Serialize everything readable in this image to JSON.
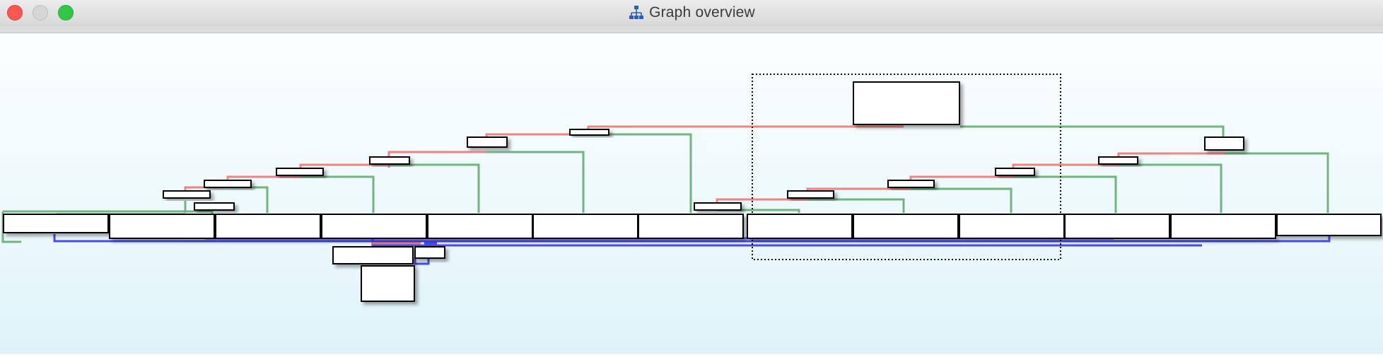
{
  "window": {
    "title": "Graph overview"
  },
  "colors": {
    "edge_red": "#ef7c7c",
    "edge_green": "#6cb07c",
    "edge_blue": "#2d2df0",
    "canvas_top": "#fbfeff",
    "canvas_bottom": "#def3f9"
  },
  "icons": {
    "close": "close-icon",
    "minimize": "minimize-icon",
    "zoom": "zoom-icon",
    "graph": "graph-tree-icon"
  }
}
